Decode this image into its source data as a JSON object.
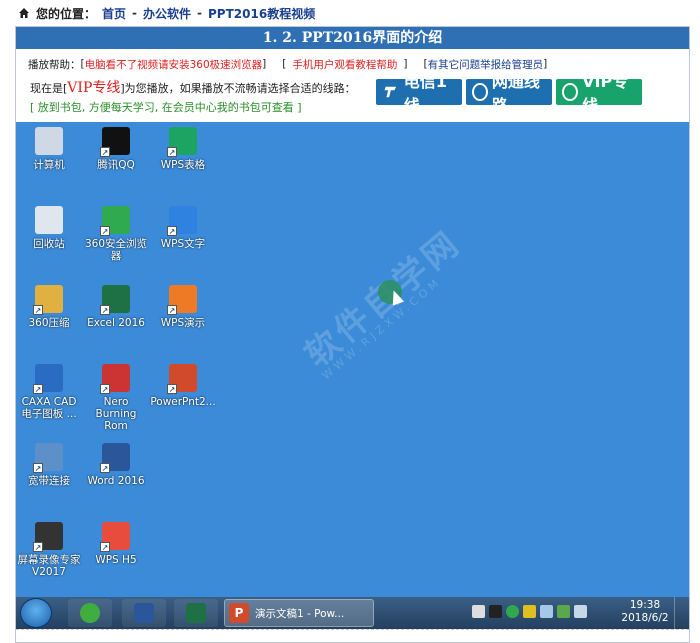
{
  "breadcrumb": {
    "prefix": "您的位置：",
    "home": "首页",
    "sep": "-",
    "category": "办公软件",
    "course": "PPT2016教程视频"
  },
  "video_title": "1. 2. PPT2016界面的介绍",
  "help": {
    "label": "播放帮助：",
    "bracket_open": "[",
    "browser": "电脑看不了视频请安装360极速浏览器",
    "bracket_close": "]",
    "mobile": "手机用户观看教程帮助",
    "report": "有其它问题举报给管理员"
  },
  "line2": {
    "before": "现在是[",
    "vip": "VIP专线",
    "after": "]为您播放，如果播放不流畅请选择合适的线路："
  },
  "line3": "[  放到书包, 方便每天学习, 在会员中心我的书包可查看  ]",
  "lines": [
    {
      "label": "电信1线"
    },
    {
      "label": "网通线路"
    },
    {
      "label": "VIP专线"
    }
  ],
  "watermark": "软件自学网",
  "watermark_url": "WWW.RJZXW.COM",
  "desktop_icons": [
    {
      "label": "计算机",
      "color": "#cfd8e4"
    },
    {
      "label": "腾讯QQ",
      "color": "#111"
    },
    {
      "label": "WPS表格",
      "color": "#1ea462"
    },
    {
      "label": "回收站",
      "color": "#dfe6ee"
    },
    {
      "label": "360安全浏览器",
      "color": "#2faa4e"
    },
    {
      "label": "WPS文字",
      "color": "#2f82e0"
    },
    {
      "label": "360压缩",
      "color": "#e0b040"
    },
    {
      "label": "Excel 2016",
      "color": "#1e7145"
    },
    {
      "label": "WPS演示",
      "color": "#ef7a25"
    },
    {
      "label": "CAXA CAD 电子图板 ...",
      "color": "#2a6bc4"
    },
    {
      "label": "Nero Burning Rom",
      "color": "#c33"
    },
    {
      "label": "PowerPnt2...",
      "color": "#d04a2b"
    },
    {
      "label": "宽带连接",
      "color": "#5d8fc9"
    },
    {
      "label": "Word 2016",
      "color": "#2b579a"
    },
    {
      "label": "屏幕录像专家 V2017",
      "color": "#333"
    },
    {
      "label": "WPS H5",
      "color": "#e84c3d"
    }
  ],
  "taskbar": {
    "ppt_window": "演示文稿1 - Pow...",
    "time": "19:38",
    "date": "2018/6/2"
  }
}
